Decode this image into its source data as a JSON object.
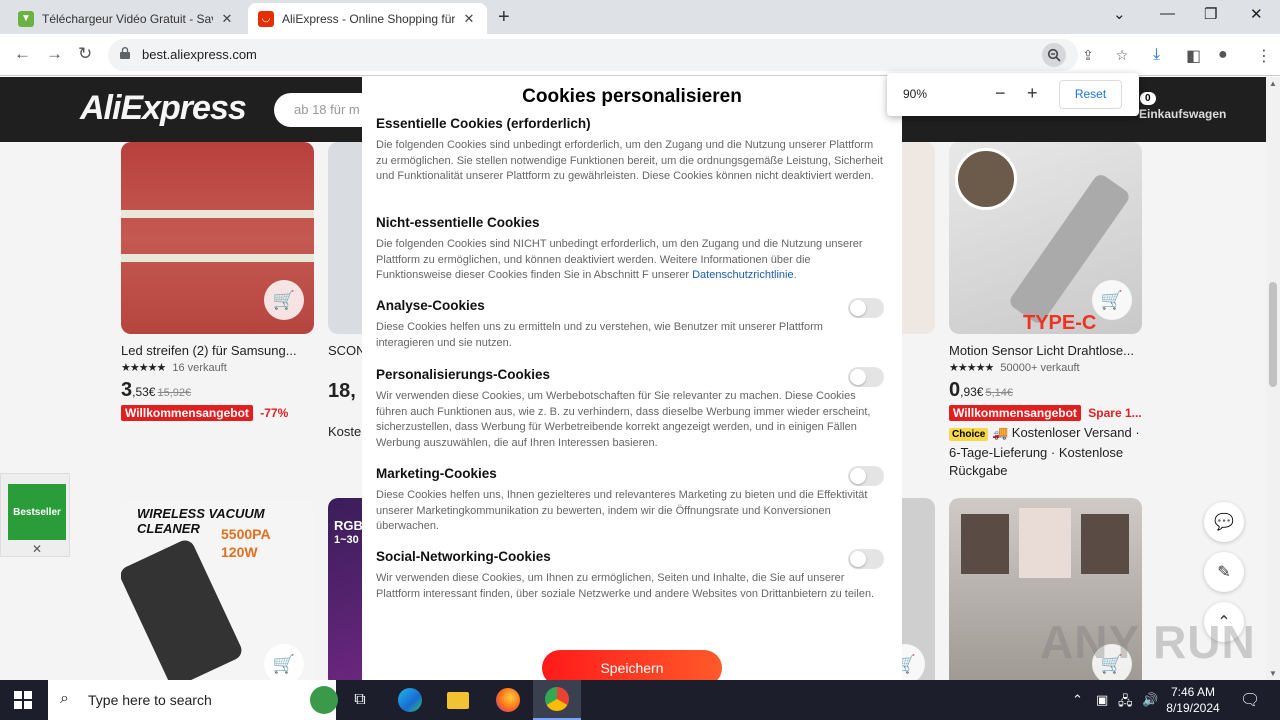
{
  "browser": {
    "tabs": [
      {
        "title": "Téléchargeur Vidéo Gratuit - Save",
        "active": false
      },
      {
        "title": "AliExpress - Online Shopping für",
        "active": true
      }
    ],
    "url": "best.aliexpress.com",
    "zoom_popup": {
      "percent": "90%",
      "reset_label": "Reset"
    }
  },
  "aliexpress": {
    "logo": "AliExpress",
    "search_placeholder": "ab 18 für m",
    "cart_count": "0",
    "cart_label": "Einkaufswagen",
    "products_row1": [
      {
        "name": "Led streifen (2) für Samsung...",
        "sold": "16 verkauft",
        "price_int": "3",
        "price_dec": ",53€",
        "old_price": "15,92€",
        "tag": "Willkommensangebot",
        "discount": "-77%"
      },
      {
        "name": "SCON",
        "price_int": "18,",
        "extra": "Koste"
      },
      {
        "name": "Motion Sensor Licht Drahtlose...",
        "sold": "50000+ verkauft",
        "price_int": "0",
        "price_dec": ",93€",
        "old_price": "5,14€",
        "tag": "Willkommensangebot",
        "discount": "Spare 1...",
        "choice": "Choice",
        "shipping": "Kostenloser Versand · 6-Tage-Lieferung · Kostenlose Rückgabe",
        "image_label": "TYPE-C"
      }
    ],
    "products_row2": [
      {
        "image_title": "WIRELESS VACUUM CLEANER",
        "image_sub1": "5500PA",
        "image_sub2": "120W"
      },
      {
        "image_title": "RGB",
        "image_sub1": "1~30"
      }
    ],
    "bestseller_label": "Bestseller",
    "bestseller_close": "✕"
  },
  "cookie_modal": {
    "title": "Cookies personalisieren",
    "sections": [
      {
        "heading": "Essentielle Cookies (erforderlich)",
        "text": "Die folgenden Cookies sind unbedingt erforderlich, um den Zugang und die Nutzung unserer Plattform zu ermöglichen. Sie stellen notwendige Funktionen bereit, um die ordnungsgemäße Leistung, Sicherheit und Funktionalität unserer Plattform zu gewährleisten. Diese Cookies können nicht deaktiviert werden."
      },
      {
        "heading": "Nicht-essentielle Cookies",
        "text": "Die folgenden Cookies sind NICHT unbedingt erforderlich, um den Zugang und die Nutzung unserer Plattform zu ermöglichen, und können deaktiviert werden. Weitere Informationen über die Funktionsweise dieser Cookies finden Sie in Abschnitt F unserer ",
        "link": "Datenschutzrichtlinie",
        "text_after": "."
      },
      {
        "heading": "Analyse-Cookies",
        "text": "Diese Cookies helfen uns zu ermitteln und zu verstehen, wie Benutzer mit unserer Plattform interagieren und sie nutzen.",
        "enabled": false
      },
      {
        "heading": "Personalisierungs-Cookies",
        "text": "Wir verwenden diese Cookies, um Werbebotschaften für Sie relevanter zu machen. Diese Cookies führen auch Funktionen aus, wie z. B. zu verhindern, dass dieselbe Werbung immer wieder erscheint, sicherzustellen, dass Werbung für Werbetreibende korrekt angezeigt werden, und in einigen Fällen Werbung auszuwählen, die auf Ihren Interessen basieren.",
        "enabled": false
      },
      {
        "heading": "Marketing-Cookies",
        "text": "Diese Cookies helfen uns, Ihnen gezielteres und relevanteres Marketing zu bieten und die Effektivität unserer Marketingkommunikation zu bewerten, indem wir die Öffnungsrate und Konversionen überwachen.",
        "enabled": false
      },
      {
        "heading": "Social-Networking-Cookies",
        "text": "Wir verwenden diese Cookies, um Ihnen zu ermöglichen, Seiten und Inhalte, die Sie auf unserer Plattform interessant finden, über soziale Netzwerke und andere Websites von Drittanbietern zu teilen.",
        "enabled": false
      }
    ],
    "save_label": "Speichern"
  },
  "watermark": "ANY RUN",
  "taskbar": {
    "search_placeholder": "Type here to search",
    "time": "7:46 AM",
    "date": "8/19/2024"
  },
  "colors": {
    "accent_red": "#e02020",
    "save_gradient_start": "#ff1a1a",
    "taskbar": "#1c1f2b"
  }
}
